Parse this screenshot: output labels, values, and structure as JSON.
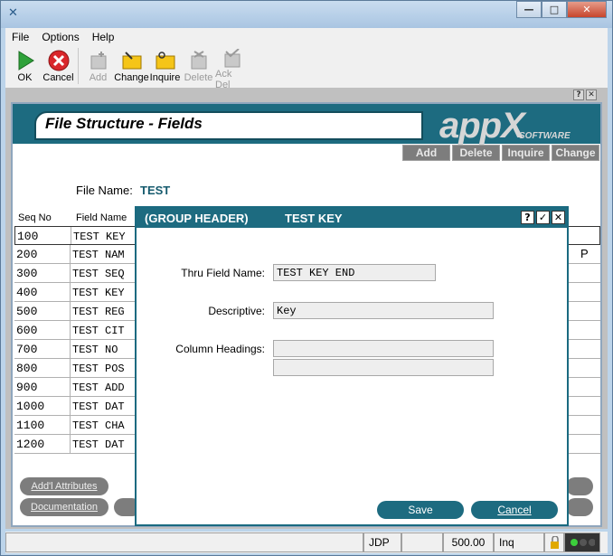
{
  "window": {
    "icon": "appx-x-icon"
  },
  "menu": [
    "File",
    "Options",
    "Help"
  ],
  "toolbar": {
    "ok": "OK",
    "cancel": "Cancel",
    "add": "Add",
    "change": "Change",
    "inquire": "Inquire",
    "delete": "Delete",
    "ack_del": "Ack Del"
  },
  "panel": {
    "title": "File Structure - Fields",
    "logo": "appX",
    "logo_sub": "SOFTWARE",
    "actions": [
      "Add",
      "Delete",
      "Inquire",
      "Change"
    ]
  },
  "file_name_label": "File Name:",
  "file_name_value": "TEST",
  "columns": {
    "seq": "Seq No",
    "field": "Field Name"
  },
  "rows": [
    {
      "seq": "100",
      "field": "TEST KEY"
    },
    {
      "seq": "200",
      "field": "TEST NAM"
    },
    {
      "seq": "300",
      "field": "TEST SEQ"
    },
    {
      "seq": "400",
      "field": "TEST KEY"
    },
    {
      "seq": "500",
      "field": "TEST REG"
    },
    {
      "seq": "600",
      "field": "TEST CIT"
    },
    {
      "seq": "700",
      "field": "TEST NO"
    },
    {
      "seq": "800",
      "field": "TEST POS"
    },
    {
      "seq": "900",
      "field": "TEST ADD"
    },
    {
      "seq": "1000",
      "field": "TEST DAT"
    },
    {
      "seq": "1100",
      "field": "TEST CHA"
    },
    {
      "seq": "1200",
      "field": "TEST DAT"
    }
  ],
  "row2_flag": "P",
  "bottom_buttons": {
    "addl": "Add'l Attributes",
    "doc": "Documentation"
  },
  "dialog": {
    "title_left": "(GROUP HEADER)",
    "title_right": "TEST KEY",
    "help": "?",
    "ok": "✓",
    "close": "✕",
    "thru_label": "Thru Field Name:",
    "thru_value": "TEST KEY END",
    "desc_label": "Descriptive:",
    "desc_value": "Key",
    "col_label": "Column Headings:",
    "col_value1": "",
    "col_value2": "",
    "save": "Save",
    "cancel": "Cancel"
  },
  "status": {
    "user": "JDP",
    "version": "500.00",
    "mode": "Inq"
  }
}
